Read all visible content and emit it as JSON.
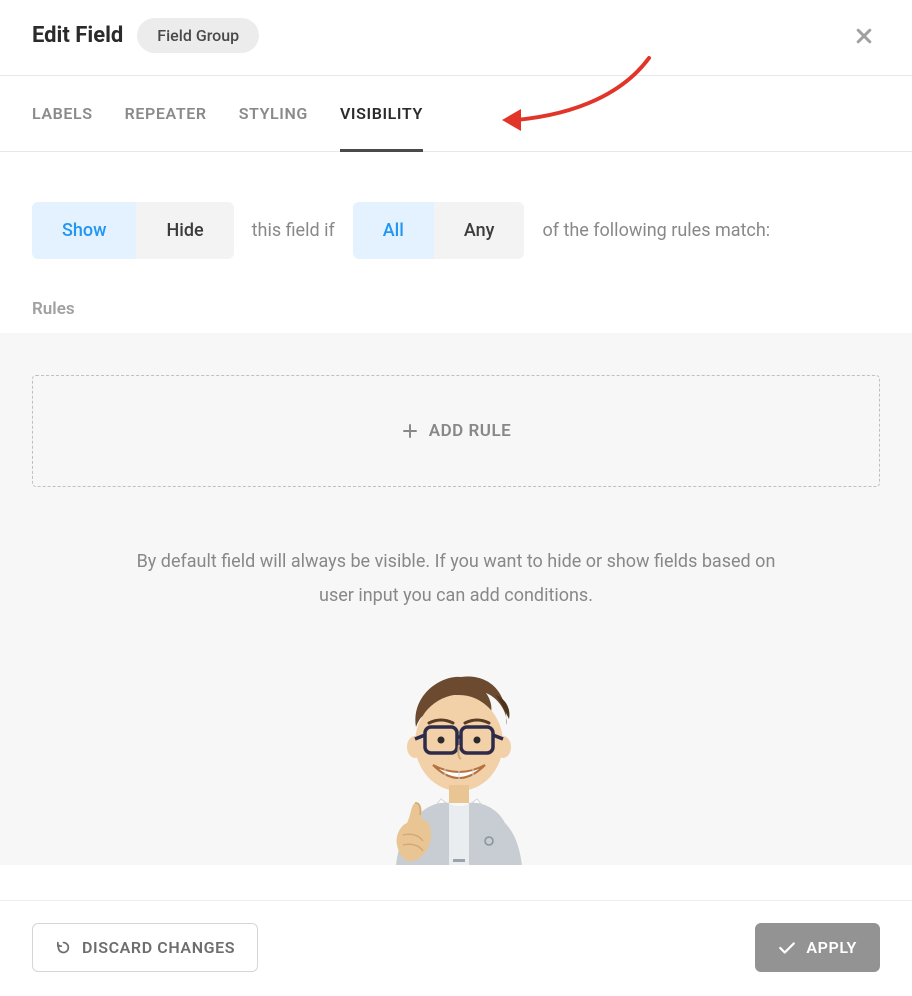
{
  "header": {
    "title": "Edit Field",
    "badge": "Field Group"
  },
  "tabs": [
    {
      "label": "LABELS",
      "active": false
    },
    {
      "label": "REPEATER",
      "active": false
    },
    {
      "label": "STYLING",
      "active": false
    },
    {
      "label": "VISIBILITY",
      "active": true
    }
  ],
  "condition": {
    "showhide": {
      "show": "Show",
      "hide": "Hide",
      "selected": "show"
    },
    "text1": "this field if",
    "allany": {
      "all": "All",
      "any": "Any",
      "selected": "all"
    },
    "text2": "of the following rules match:"
  },
  "rules": {
    "label": "Rules",
    "add_rule": "ADD RULE"
  },
  "help_text": "By default field will always be visible. If you want to hide or show fields based on user input you can add conditions.",
  "footer": {
    "discard": "DISCARD CHANGES",
    "apply": "APPLY"
  },
  "colors": {
    "accent_blue": "#2196f3",
    "accent_bg": "#e3f2fe",
    "annotation_red": "#e2352a"
  }
}
